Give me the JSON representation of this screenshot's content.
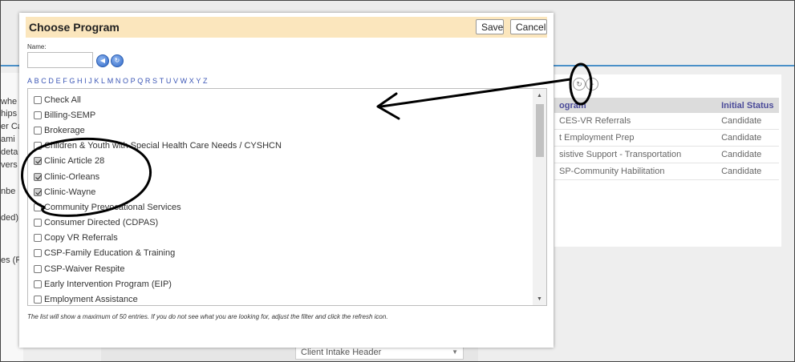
{
  "background": {
    "left_fragments": [
      "whe",
      "hips",
      "er Ca",
      "ami",
      "deta",
      "vers",
      "nbe",
      "ded)",
      "es (Fo"
    ],
    "program_table": {
      "headers": [
        "ogram",
        "Initial Status"
      ],
      "rows": [
        {
          "program": "CES-VR Referrals",
          "status": "Candidate"
        },
        {
          "program": "t Employment Prep",
          "status": "Candidate"
        },
        {
          "program": "sistive Support - Transportation",
          "status": "Candidate"
        },
        {
          "program": "SP-Community Habilitation",
          "status": "Candidate"
        }
      ]
    },
    "select_value": "Client Intake Header"
  },
  "dialog": {
    "title": "Choose Program",
    "save_label": "Save",
    "cancel_label": "Cancel",
    "name_label": "Name:",
    "name_value": "",
    "alphabet": [
      "A",
      "B",
      "C",
      "D",
      "E",
      "F",
      "G",
      "H",
      "I",
      "J",
      "K",
      "L",
      "M",
      "N",
      "O",
      "P",
      "Q",
      "R",
      "S",
      "T",
      "U",
      "V",
      "W",
      "X",
      "Y",
      "Z"
    ],
    "items": [
      {
        "label": "Check All",
        "checked": false
      },
      {
        "label": "Billing-SEMP",
        "checked": false
      },
      {
        "label": "Brokerage",
        "checked": false
      },
      {
        "label": "Children & Youth with Special Health Care Needs / CYSHCN",
        "checked": false
      },
      {
        "label": "Clinic Article 28",
        "checked": true
      },
      {
        "label": "Clinic-Orleans",
        "checked": true
      },
      {
        "label": "Clinic-Wayne",
        "checked": true
      },
      {
        "label": "Community Prevocational Services",
        "checked": false
      },
      {
        "label": "Consumer Directed (CDPAS)",
        "checked": false
      },
      {
        "label": "Copy VR Referrals",
        "checked": false
      },
      {
        "label": "CSP-Family Education & Training",
        "checked": false
      },
      {
        "label": "CSP-Waiver Respite",
        "checked": false
      },
      {
        "label": "Early Intervention Program (EIP)",
        "checked": false
      },
      {
        "label": "Employment Assistance",
        "checked": false
      }
    ],
    "footnote": "The list will show a maximum of 50 entries. If you do not see what you are looking for, adjust the filter and click the refresh icon."
  }
}
